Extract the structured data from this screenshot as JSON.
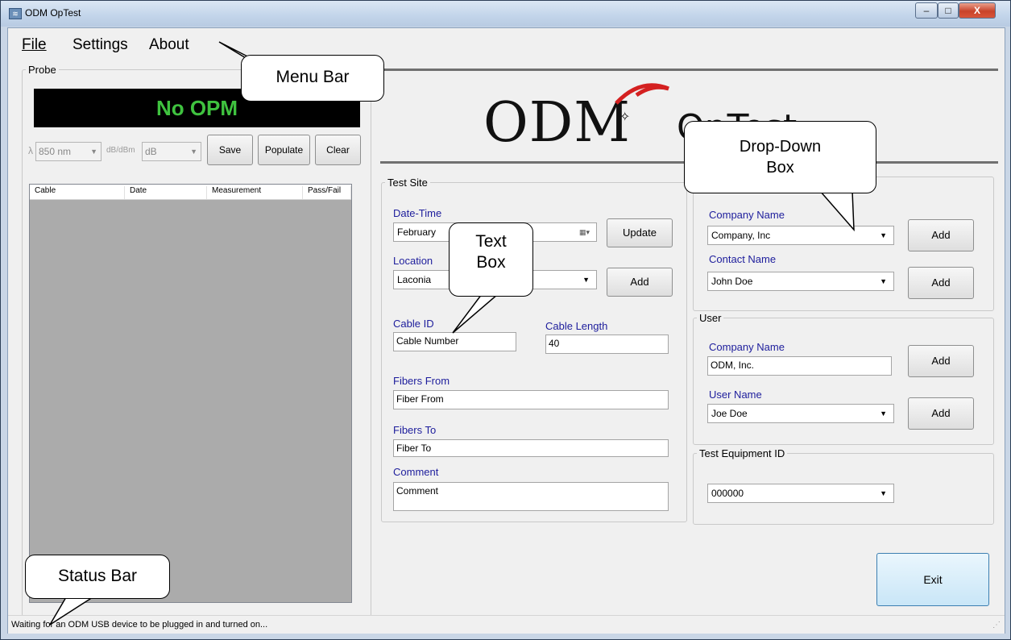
{
  "window": {
    "title": "ODM OpTest",
    "min_label": "–",
    "max_label": "□",
    "close_label": "X"
  },
  "menu": {
    "file": "File",
    "settings": "Settings",
    "about": "About"
  },
  "probe": {
    "group_label": "Probe",
    "display_text": "No OPM",
    "wavelength_symbol": "λ",
    "wavelength_value": "850 nm",
    "unit_label": "dB/dBm",
    "unit_value": "dB",
    "save_label": "Save",
    "populate_label": "Populate",
    "clear_label": "Clear",
    "columns": [
      "Cable",
      "Date",
      "Measurement",
      "Pass/Fail"
    ]
  },
  "logo": {
    "brand": "ODM",
    "product": "OpTest"
  },
  "test_site": {
    "group_label": "Test Site",
    "date_time_label": "Date-Time",
    "date_time_value": "February",
    "update_label": "Update",
    "location_label": "Location",
    "location_value": "Laconia",
    "location_add_label": "Add",
    "cable_id_label": "Cable ID",
    "cable_id_value": "Cable Number",
    "cable_length_label": "Cable Length",
    "cable_length_value": "40",
    "fibers_from_label": "Fibers From",
    "fibers_from_value": "Fiber From",
    "fibers_to_label": "Fibers To",
    "fibers_to_value": "Fiber To",
    "comment_label": "Comment",
    "comment_value": "Comment"
  },
  "customer": {
    "company_name_label": "Company Name",
    "company_name_value": "Company, Inc",
    "company_add_label": "Add",
    "contact_name_label": "Contact Name",
    "contact_name_value": "John Doe",
    "contact_add_label": "Add"
  },
  "user": {
    "group_label": "User",
    "company_name_label": "Company Name",
    "company_name_value": "ODM, Inc.",
    "company_add_label": "Add",
    "user_name_label": "User Name",
    "user_name_value": "Joe Doe",
    "user_add_label": "Add"
  },
  "equipment": {
    "group_label": "Test Equipment ID",
    "value": "000000"
  },
  "exit_label": "Exit",
  "status": {
    "text": "Waiting for an ODM USB device to be plugged in and turned on..."
  },
  "callouts": {
    "menu_bar": "Menu Bar",
    "text_box_line1": "Text",
    "text_box_line2": "Box",
    "drop_down_line1": "Drop-Down",
    "drop_down_line2": "Box",
    "status_bar": "Status Bar"
  }
}
